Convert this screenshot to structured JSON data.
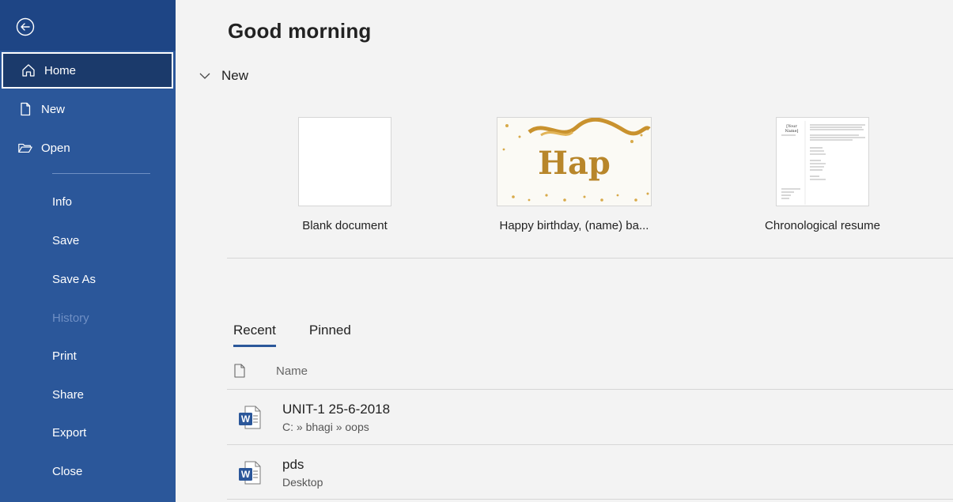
{
  "sidebar": {
    "back_icon": "back-arrow-circle-icon",
    "items": [
      {
        "label": "Home",
        "icon": "home-icon"
      },
      {
        "label": "New",
        "icon": "new-document-icon"
      },
      {
        "label": "Open",
        "icon": "open-folder-icon"
      },
      {
        "label": "Info"
      },
      {
        "label": "Save"
      },
      {
        "label": "Save As"
      },
      {
        "label": "History"
      },
      {
        "label": "Print"
      },
      {
        "label": "Share"
      },
      {
        "label": "Export"
      },
      {
        "label": "Close"
      }
    ]
  },
  "main": {
    "greeting": "Good morning",
    "new_section": {
      "title": "New"
    },
    "templates": [
      {
        "label": "Blank document"
      },
      {
        "label": "Happy birthday, (name) ba...",
        "thumb_text": "Hap"
      },
      {
        "label": "Chronological resume",
        "thumb_text": "[Your Name]"
      }
    ],
    "tabs": [
      {
        "label": "Recent"
      },
      {
        "label": "Pinned"
      }
    ],
    "list_header": {
      "name": "Name"
    },
    "files": [
      {
        "name": "UNIT-1 25-6-2018",
        "path": "C: » bhagi » oops"
      },
      {
        "name": "pds",
        "path": "Desktop"
      }
    ],
    "word_icon_letter": "W"
  },
  "colors": {
    "sidebar_bg": "#2b579a",
    "accent": "#2b579a",
    "main_bg": "#f3f3f3"
  }
}
